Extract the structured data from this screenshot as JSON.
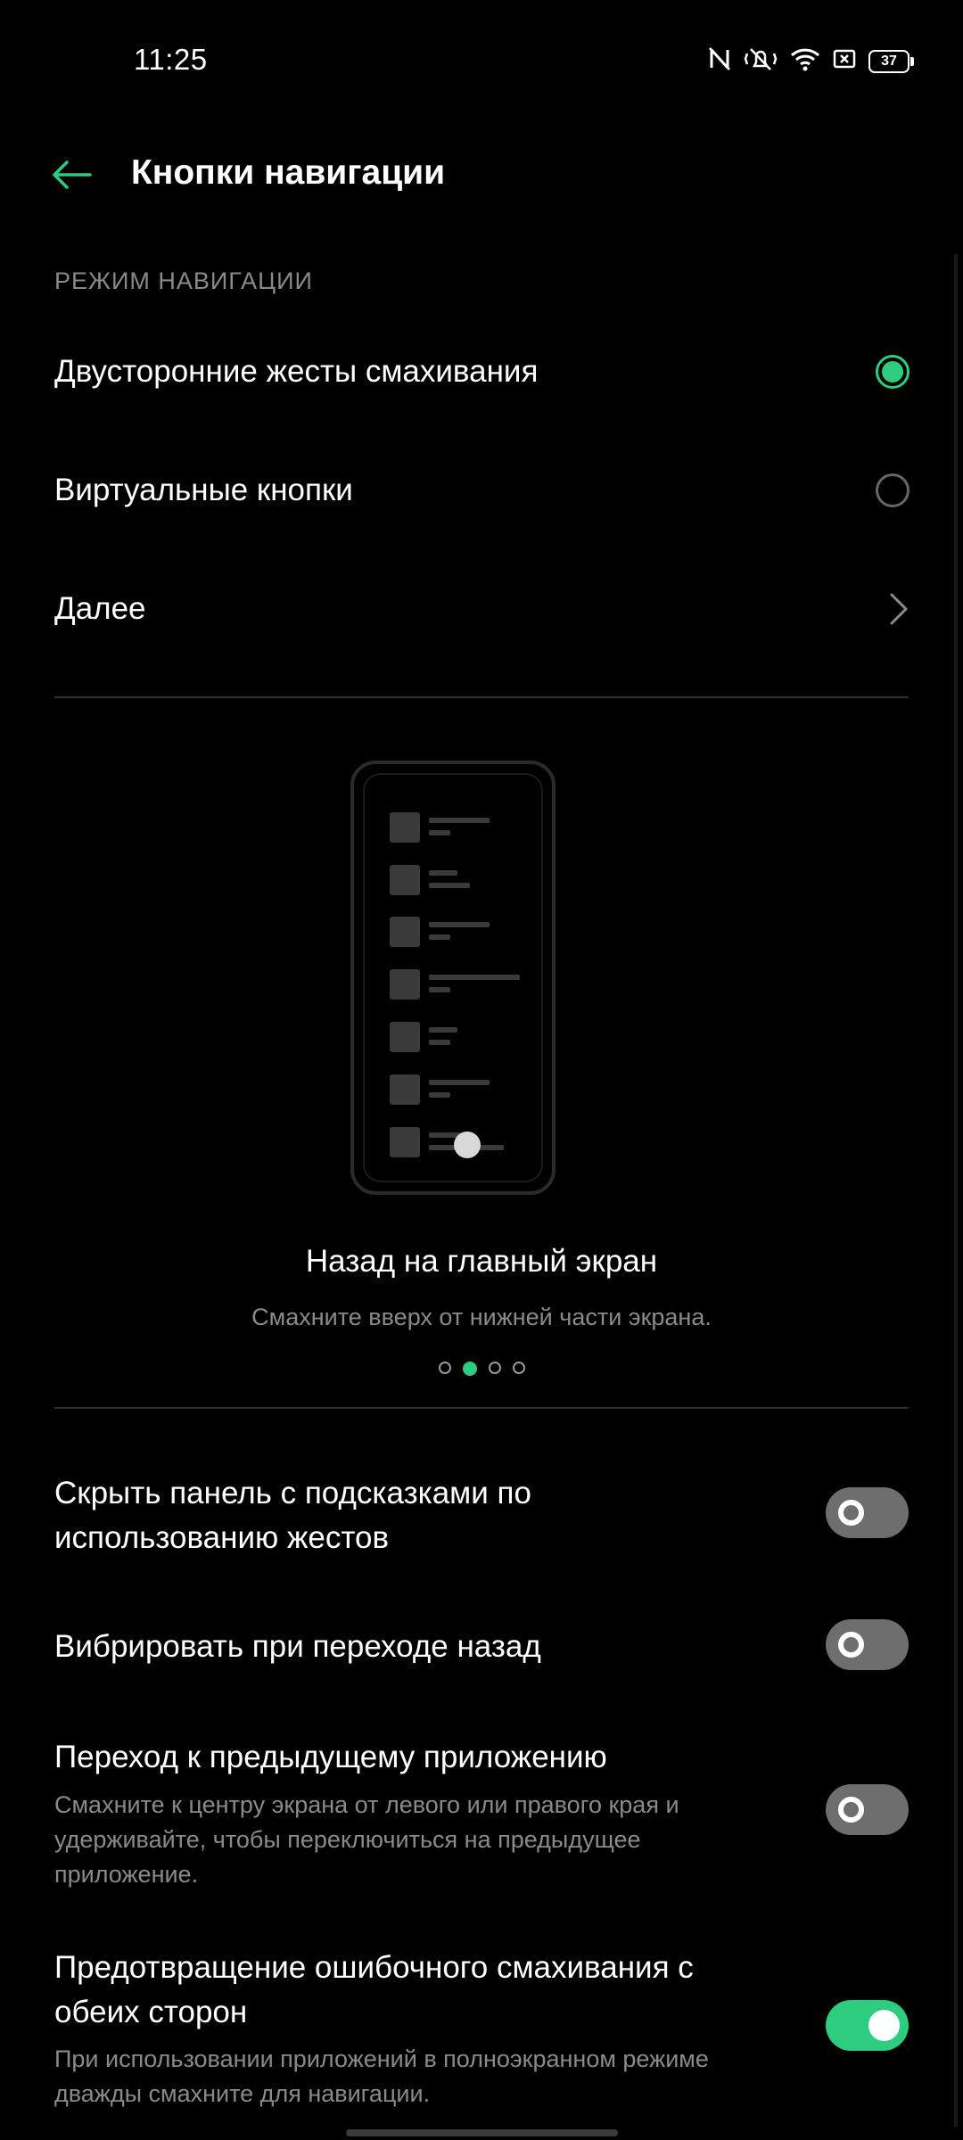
{
  "status_bar": {
    "time": "11:25",
    "battery": "37"
  },
  "header": {
    "title": "Кнопки навигации"
  },
  "navigation_mode": {
    "section_title": "РЕЖИМ НАВИГАЦИИ",
    "options": [
      {
        "label": "Двусторонние жесты смахивания",
        "selected": true
      },
      {
        "label": "Виртуальные кнопки",
        "selected": false
      }
    ],
    "more_label": "Далее"
  },
  "illustration": {
    "title": "Назад на главный экран",
    "subtitle": "Смахните вверх от нижней части экрана.",
    "pages": 4,
    "active_page": 2
  },
  "settings": [
    {
      "label": "Скрыть панель с подсказками по использованию жестов",
      "description": "",
      "enabled": false
    },
    {
      "label": "Вибрировать при переходе назад",
      "description": "",
      "enabled": false
    },
    {
      "label": "Переход к предыдущему приложению",
      "description": "Смахните к центру экрана от левого или правого края и удерживайте, чтобы переключиться на предыдущее приложение.",
      "enabled": false
    },
    {
      "label": "Предотвращение ошибочного смахивания с обеих сторон",
      "description": "При использовании приложений в полноэкранном режиме дважды смахните для навигации.",
      "enabled": true
    }
  ],
  "colors": {
    "accent": "#2ecc7f",
    "background": "#000000",
    "secondary_text": "#8a8a8a"
  }
}
